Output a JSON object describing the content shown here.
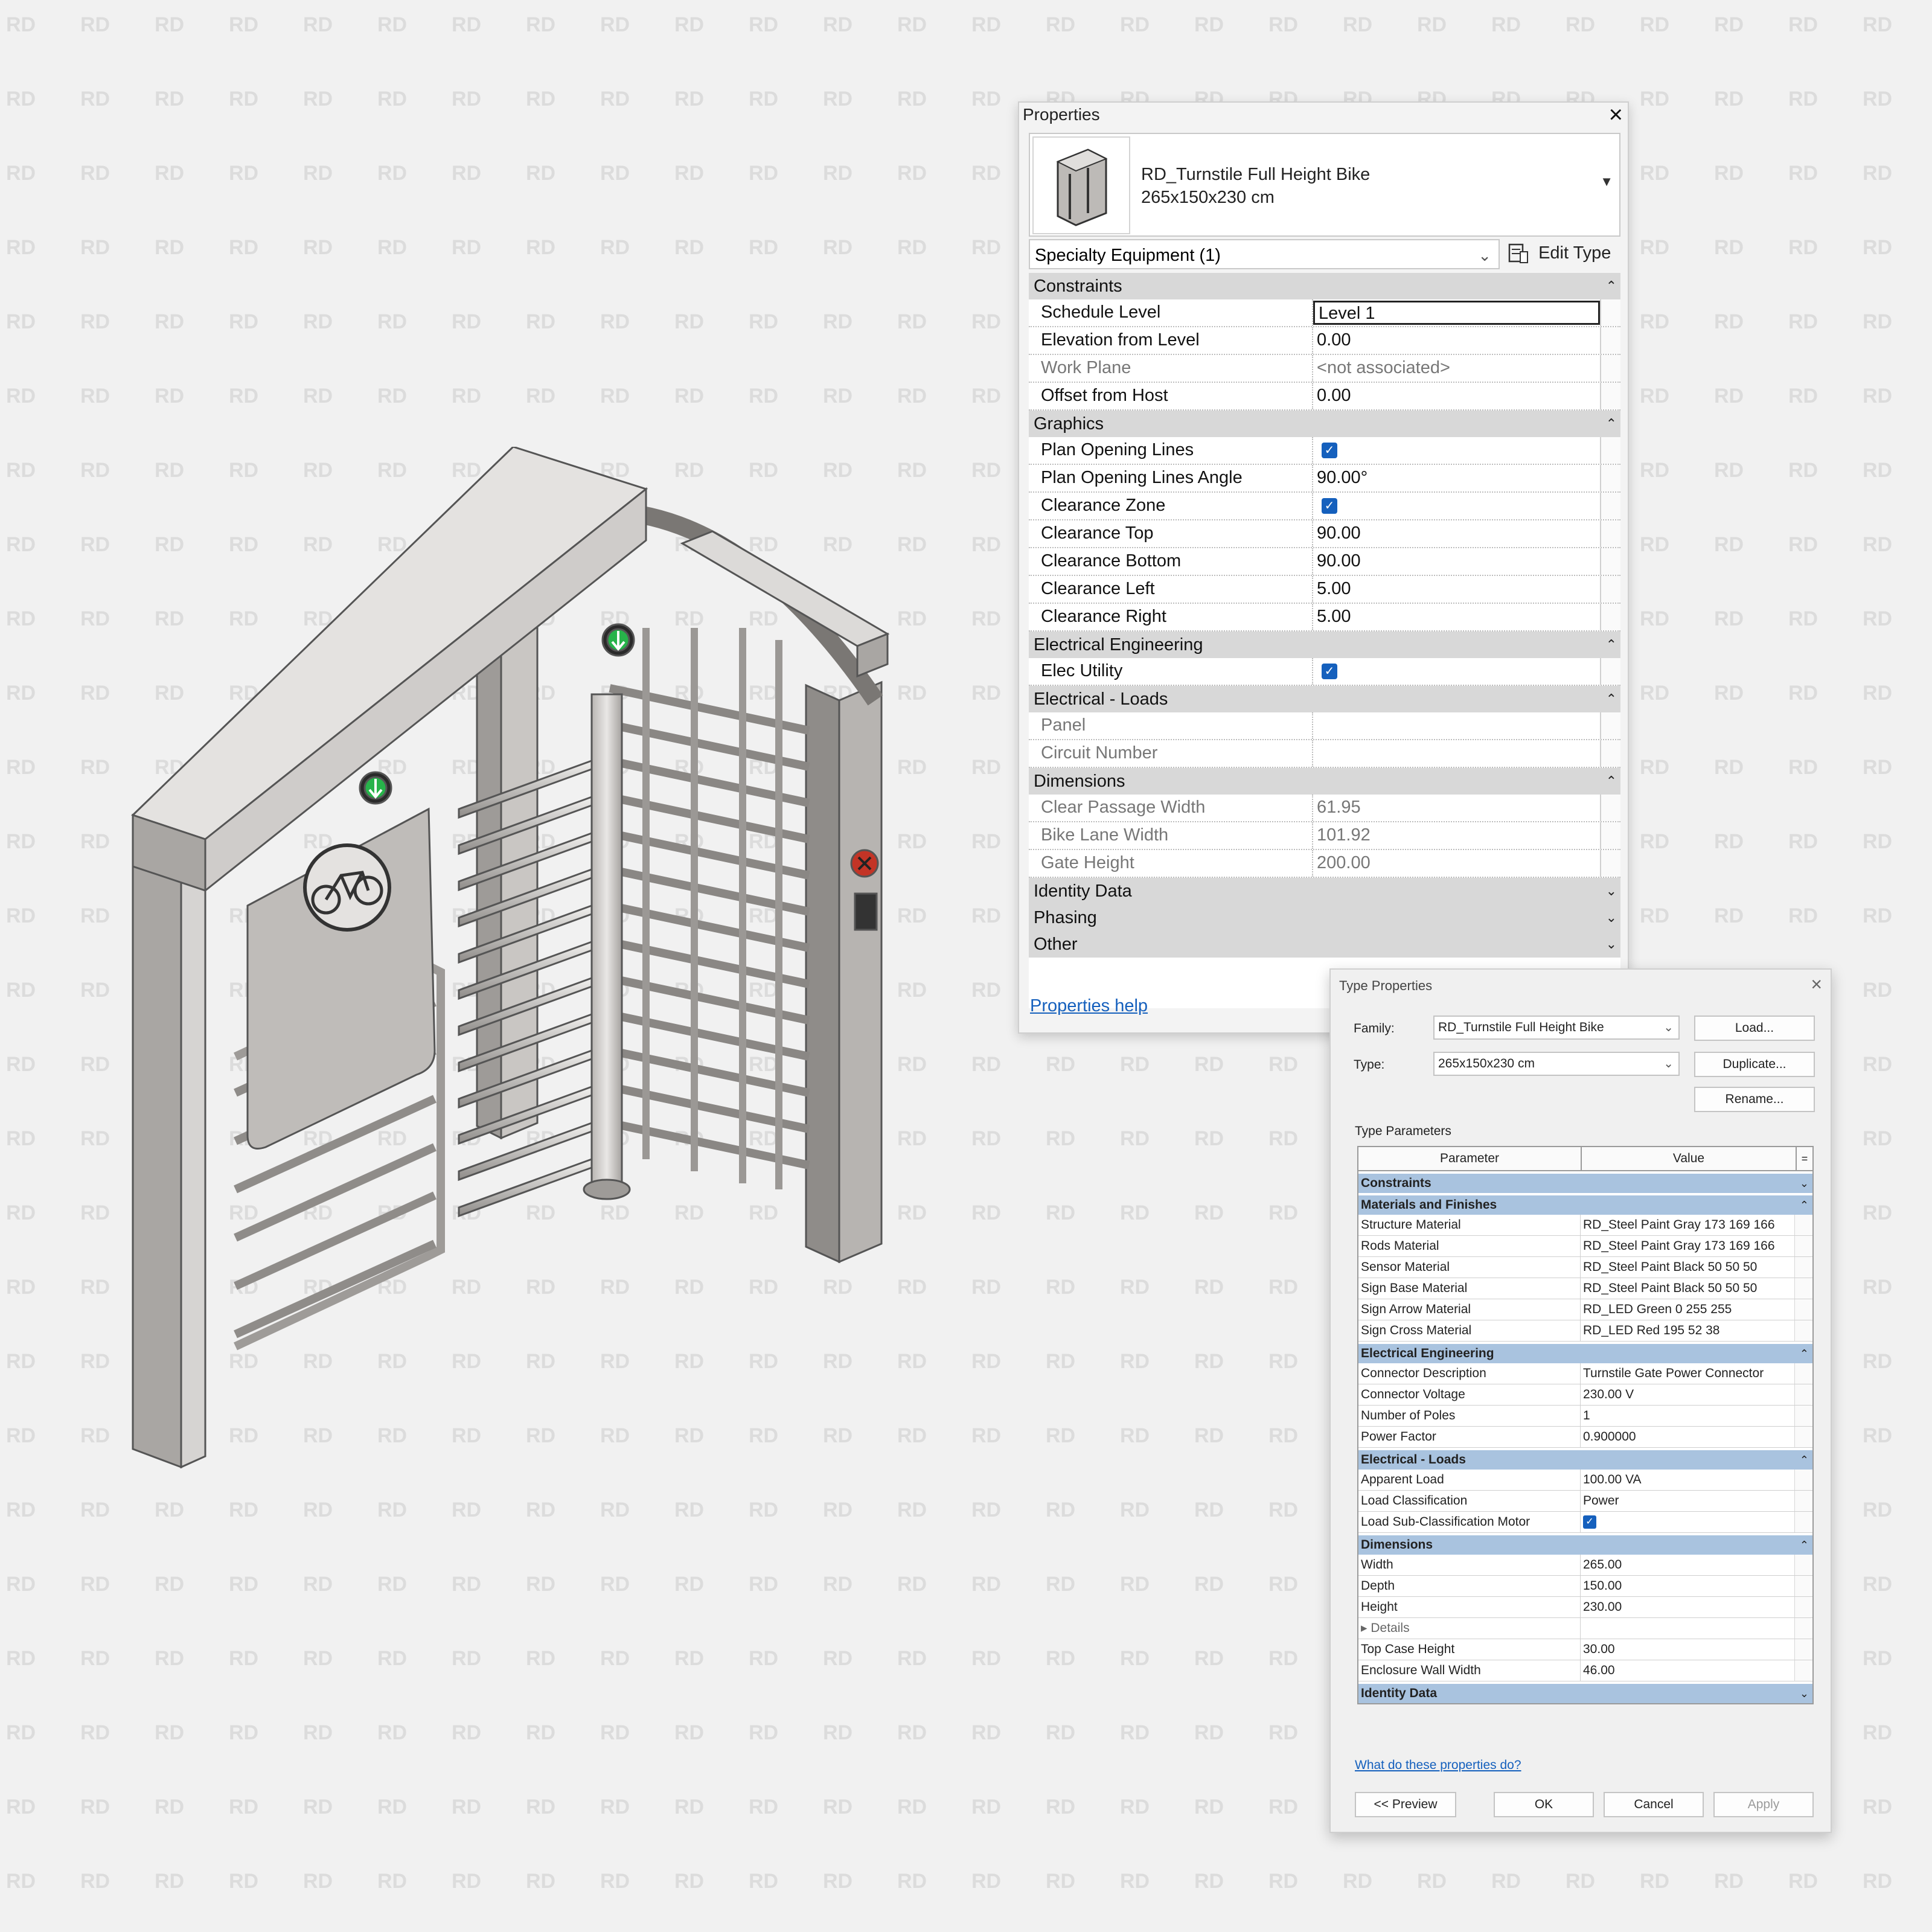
{
  "watermark_text": "RD",
  "properties": {
    "title": "Properties",
    "type_name_line1": "RD_Turnstile Full Height Bike",
    "type_name_line2": "265x150x230 cm",
    "selector": "Specialty Equipment (1)",
    "edit_type": "Edit Type",
    "help": "Properties help",
    "groups": [
      {
        "name": "Constraints",
        "toggle": "⌃",
        "rows": [
          {
            "name": "Schedule Level",
            "value": "Level 1",
            "boxed": true
          },
          {
            "name": "Elevation from Level",
            "value": "0.00"
          },
          {
            "name": "Work Plane",
            "value": "<not associated>",
            "dim": true
          },
          {
            "name": "Offset from Host",
            "value": "0.00"
          }
        ]
      },
      {
        "name": "Graphics",
        "toggle": "⌃",
        "rows": [
          {
            "name": "Plan Opening Lines",
            "checked": true
          },
          {
            "name": "Plan Opening Lines Angle",
            "value": "90.00°"
          },
          {
            "name": "Clearance Zone",
            "checked": true
          },
          {
            "name": "Clearance Top",
            "value": "90.00"
          },
          {
            "name": "Clearance Bottom",
            "value": "90.00"
          },
          {
            "name": "Clearance Left",
            "value": "5.00"
          },
          {
            "name": "Clearance Right",
            "value": "5.00"
          }
        ]
      },
      {
        "name": "Electrical Engineering",
        "toggle": "⌃",
        "rows": [
          {
            "name": "Elec Utility",
            "checked": true
          }
        ]
      },
      {
        "name": "Electrical - Loads",
        "toggle": "⌃",
        "rows": [
          {
            "name": "Panel",
            "value": "",
            "dim": true
          },
          {
            "name": "Circuit Number",
            "value": "",
            "dim": true
          }
        ]
      },
      {
        "name": "Dimensions",
        "toggle": "⌃",
        "rows": [
          {
            "name": "Clear Passage Width",
            "value": "61.95",
            "dim": true
          },
          {
            "name": "Bike Lane Width",
            "value": "101.92",
            "dim": true
          },
          {
            "name": "Gate Height",
            "value": "200.00",
            "dim": true
          }
        ]
      },
      {
        "name": "Identity Data",
        "toggle": "⌄",
        "rows": []
      },
      {
        "name": "Phasing",
        "toggle": "⌄",
        "rows": []
      },
      {
        "name": "Other",
        "toggle": "⌄",
        "rows": []
      }
    ]
  },
  "type_properties": {
    "title": "Type Properties",
    "family_label": "Family:",
    "family_value": "RD_Turnstile Full Height Bike",
    "type_label": "Type:",
    "type_value": "265x150x230 cm",
    "load": "Load...",
    "duplicate": "Duplicate...",
    "rename": "Rename...",
    "type_parameters": "Type Parameters",
    "col_parameter": "Parameter",
    "col_value": "Value",
    "col_eq": "=",
    "groups": [
      {
        "name": "Constraints",
        "toggle": "⌄",
        "rows": []
      },
      {
        "name": "Materials and Finishes",
        "toggle": "⌃",
        "rows": [
          {
            "name": "Structure Material",
            "value": "RD_Steel Paint Gray 173 169 166"
          },
          {
            "name": "Rods Material",
            "value": "RD_Steel Paint Gray 173 169 166"
          },
          {
            "name": "Sensor Material",
            "value": "RD_Steel Paint Black 50 50 50"
          },
          {
            "name": "Sign Base Material",
            "value": "RD_Steel Paint Black 50 50 50"
          },
          {
            "name": "Sign Arrow Material",
            "value": "RD_LED Green 0 255 255"
          },
          {
            "name": "Sign Cross Material",
            "value": "RD_LED Red 195 52 38"
          }
        ]
      },
      {
        "name": "Electrical Engineering",
        "toggle": "⌃",
        "rows": [
          {
            "name": "Connector Description",
            "value": "Turnstile Gate Power Connector"
          },
          {
            "name": "Connector Voltage",
            "value": "230.00 V"
          },
          {
            "name": "Number of Poles",
            "value": "1"
          },
          {
            "name": "Power Factor",
            "value": "0.900000"
          }
        ]
      },
      {
        "name": "Electrical - Loads",
        "toggle": "⌃",
        "rows": [
          {
            "name": "Apparent Load",
            "value": "100.00 VA"
          },
          {
            "name": "Load Classification",
            "value": "Power"
          },
          {
            "name": "Load Sub-Classification Motor",
            "checked": true
          }
        ]
      },
      {
        "name": "Dimensions",
        "toggle": "⌃",
        "rows": [
          {
            "name": "Width",
            "value": "265.00"
          },
          {
            "name": "Depth",
            "value": "150.00"
          },
          {
            "name": "Height",
            "value": "230.00"
          },
          {
            "name": "▸ Details",
            "value": "",
            "sub": true
          },
          {
            "name": "Top Case Height",
            "value": "30.00"
          },
          {
            "name": "Enclosure Wall Width",
            "value": "46.00"
          }
        ]
      },
      {
        "name": "Identity Data",
        "toggle": "⌄",
        "rows": []
      }
    ],
    "help": "What do these properties do?",
    "preview": "<< Preview",
    "ok": "OK",
    "cancel": "Cancel",
    "apply": "Apply"
  }
}
